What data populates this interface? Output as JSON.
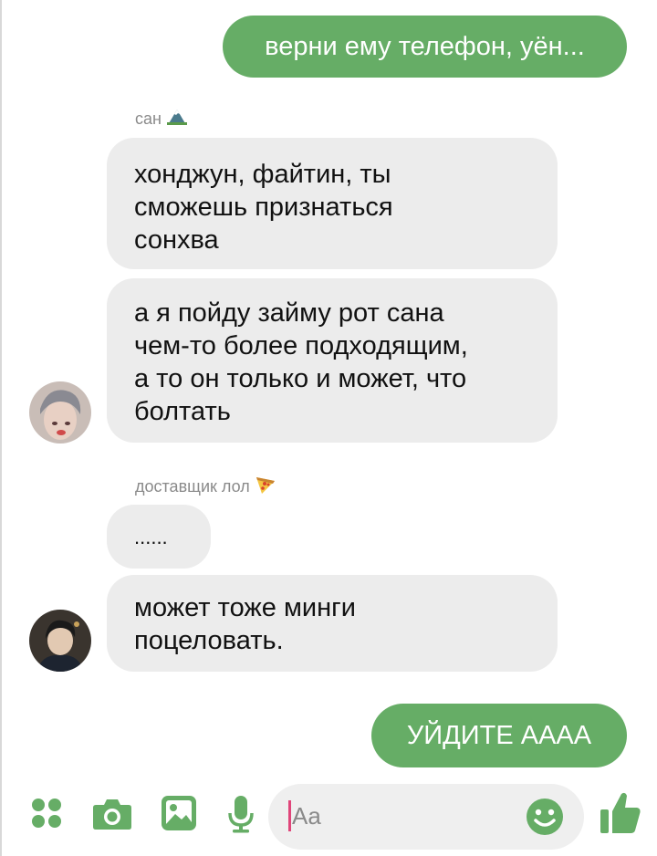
{
  "messages": {
    "out_1": "верни ему телефон, уён...",
    "san_name": "сан",
    "san_1_lines": [
      "хонджун, файтин, ты",
      "сможешь признаться",
      "сонхва"
    ],
    "san_2_lines": [
      "а я пойду займу рот сана",
      "чем-то более подходящим,",
      "а то он только и может, что",
      "болтать"
    ],
    "courier_name": "доставщик лол",
    "courier_1": "......",
    "courier_2_lines": [
      "может тоже минги",
      "поцеловать."
    ],
    "out_2": "УЙДИТЕ АААА"
  },
  "composer": {
    "placeholder": "Aa",
    "icons": [
      "apps-icon",
      "camera-icon",
      "gallery-icon",
      "microphone-icon",
      "emoji-icon",
      "like-icon"
    ]
  },
  "colors": {
    "accent": "#66ad66",
    "incoming_bubble": "#ececec",
    "caret": "#e0457a"
  }
}
